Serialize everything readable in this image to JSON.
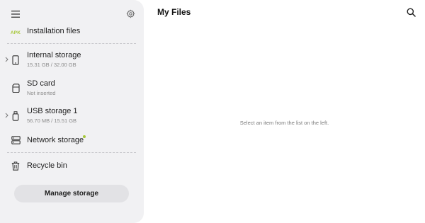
{
  "sidebar": {
    "menu_icon": "hamburger-menu-icon",
    "settings_icon": "gear-icon",
    "items": [
      {
        "label": "Installation files",
        "icon": "apk-badge-icon",
        "icon_text": "APK"
      },
      {
        "label": "Internal storage",
        "sublabel": "15.31 GB / 32.00 GB",
        "icon": "phone-icon",
        "expandable": true
      },
      {
        "label": "SD card",
        "sublabel": "Not inserted",
        "icon": "sd-card-icon"
      },
      {
        "label": "USB storage 1",
        "sublabel": "56.70 MB / 15.51 GB",
        "icon": "usb-icon",
        "expandable": true
      },
      {
        "label": "Network storage",
        "icon": "server-icon",
        "badge_color": "#a7c83a"
      },
      {
        "label": "Recycle bin",
        "icon": "trash-icon"
      }
    ],
    "manage_button": "Manage storage"
  },
  "main": {
    "title": "My Files",
    "search_icon": "search-icon",
    "empty_message": "Select an item from the list on the left."
  },
  "colors": {
    "sidebar_bg": "#f1f1f3",
    "button_bg": "#e2e2e5",
    "apk_green": "#a7c83a",
    "text": "#1f1f1f",
    "subtext": "#8a8a8a"
  }
}
